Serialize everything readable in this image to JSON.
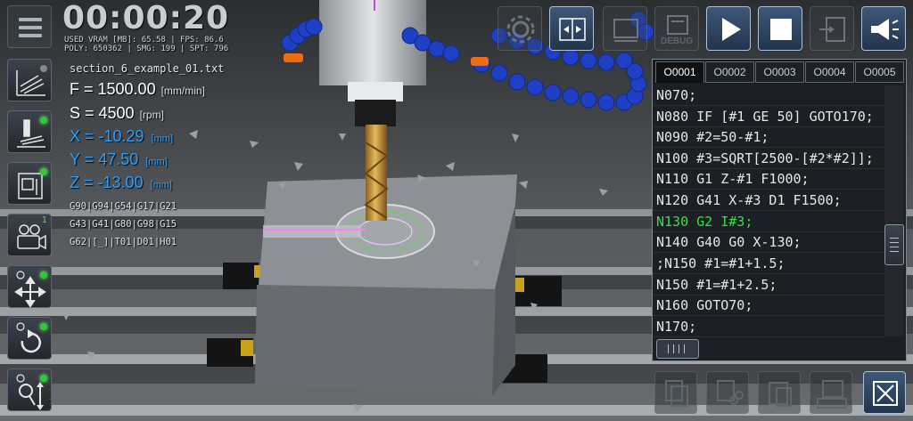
{
  "hud": {
    "timer": "00:00:20",
    "stats_line1": "USED VRAM [MB]: 65.58 | FPS: 86.6",
    "stats_line2": "POLY: 650362 | SMG: 199 | SPT: 796",
    "filename": "section_6_example_01.txt",
    "feed_label": "F = 1500.00",
    "feed_unit": "[mm/min]",
    "speed_label": "S = 4500",
    "speed_unit": "[rpm]",
    "x_label": "X = -10.29",
    "y_label": "Y = 47.50",
    "z_label": "Z = -13.00",
    "axis_unit": "[mm]",
    "gcodes_line1": "G90|G94|G54|G17|G21",
    "gcodes_line2": "G43|G41|G80|G98|G15",
    "gcodes_line3": "G62|[_]|T01|D01|H01"
  },
  "left_toolbar": {
    "camera_badge": "1"
  },
  "top_toolbar": {
    "debug_label": "DEBUG"
  },
  "editor": {
    "tabs": [
      "O0001",
      "O0002",
      "O0003",
      "O0004",
      "O0005"
    ],
    "active_tab": "O0001",
    "lines": [
      "N070;",
      "N080 IF [#1 GE 50] GOTO170;",
      "N090 #2=50-#1;",
      "N100 #3=SQRT[2500-[#2*#2]];",
      "N110 G1 Z-#1 F1000;",
      "N120 G41 X-#3 D1 F1500;",
      "N130 G2 I#3;",
      "N140 G40 G0 X-130;",
      ";N150 #1=#1+1.5;",
      "N150 #1=#1+2.5;",
      "N160 GOTO70;",
      "N170;"
    ],
    "current_line": "N130 G2 I#3;"
  },
  "colors": {
    "accent_blue": "#29a0ff",
    "current_line_green": "#33e045",
    "status_led_green": "#2ec938"
  }
}
